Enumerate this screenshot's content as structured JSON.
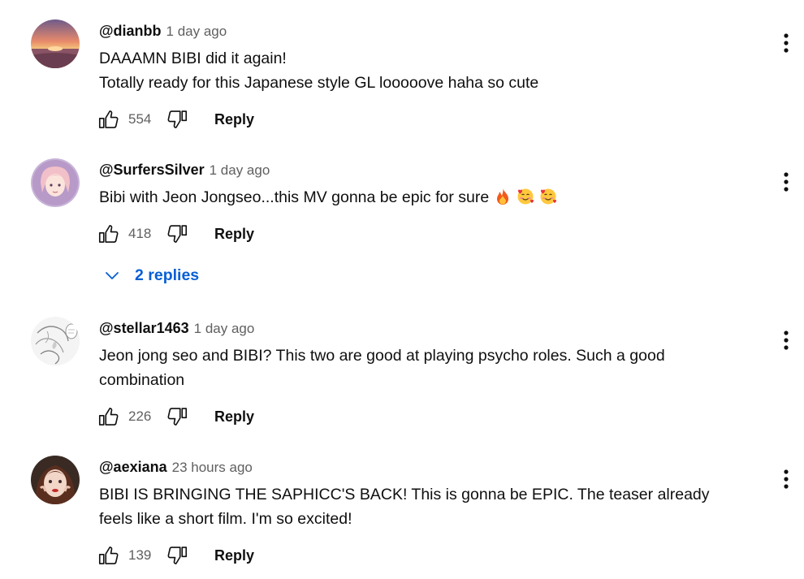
{
  "comments": [
    {
      "author": "@dianbb",
      "time": "1 day ago",
      "lines": [
        "DAAAMN BIBI did it again!",
        "Totally ready for this Japanese style GL looooove haha so cute"
      ],
      "likes": "554",
      "reply_label": "Reply"
    },
    {
      "author": "@SurfersSilver",
      "time": "1 day ago",
      "lines": [
        "Bibi with Jeon Jongseo...this MV gonna be epic for sure"
      ],
      "emojis": [
        "fire-emoji",
        "smiling-face-with-hearts-emoji",
        "smiling-face-with-hearts-emoji"
      ],
      "likes": "418",
      "reply_label": "Reply",
      "replies_label": "2 replies"
    },
    {
      "author": "@stellar1463",
      "time": "1 day ago",
      "lines": [
        "Jeon jong seo and BIBI? This two are good at playing psycho roles. Such a good",
        "combination"
      ],
      "likes": "226",
      "reply_label": "Reply"
    },
    {
      "author": "@aexiana",
      "time": "23 hours ago",
      "lines": [
        "BIBI IS BRINGING THE SAPHICC'S BACK! This is gonna be EPIC. The teaser already",
        "feels like a short film. I'm so excited!"
      ],
      "likes": "139",
      "reply_label": "Reply"
    }
  ],
  "colors": {
    "text_primary": "#0f0f0f",
    "text_secondary": "#606060",
    "link_blue": "#065fd4"
  }
}
